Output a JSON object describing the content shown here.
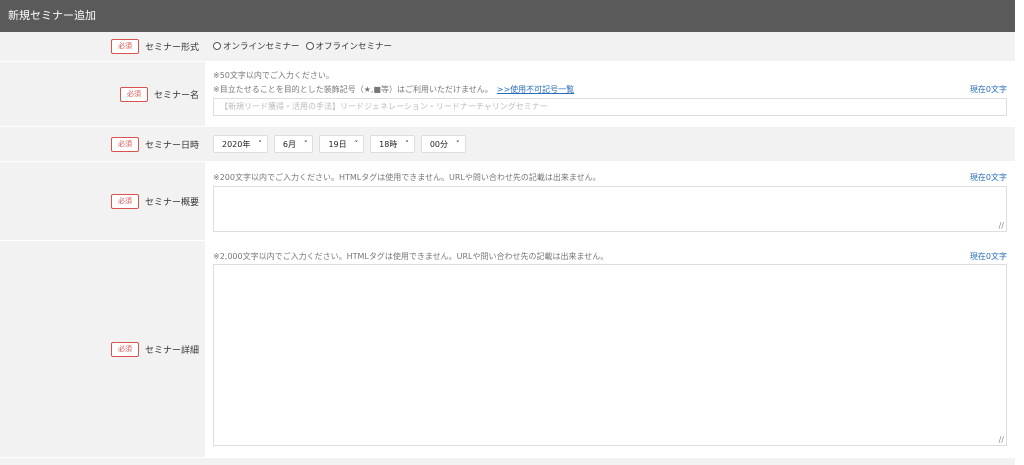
{
  "header": {
    "title": "新規セミナー追加"
  },
  "required_label": "必須",
  "format": {
    "label": "セミナー形式",
    "options": [
      "オンラインセミナー",
      "オフラインセミナー"
    ]
  },
  "name": {
    "label": "セミナー名",
    "note1": "※50文字以内でご入力ください。",
    "note2": "※目立たせることを目的とした装飾記号（★,■等）はご利用いただけません。",
    "link": ">>使用不可記号一覧",
    "counter": "現在0文字",
    "placeholder": "【新規リード獲得・活用の手法】リードジェネレーション・リードナーチャリングセミナー"
  },
  "datetime": {
    "label": "セミナー日時",
    "year": "2020年",
    "month": "6月",
    "day": "19日",
    "hour": "18時",
    "minute": "00分"
  },
  "summary": {
    "label": "セミナー概要",
    "note": "※200文字以内でご入力ください。HTMLタグは使用できません。URLや問い合わせ先の記載は出来ません。",
    "counter": "現在0文字"
  },
  "detail": {
    "label": "セミナー詳細",
    "note": "※2,000文字以内でご入力ください。HTMLタグは使用できません。URLや問い合わせ先の記載は出来ません。",
    "counter": "現在0文字"
  }
}
